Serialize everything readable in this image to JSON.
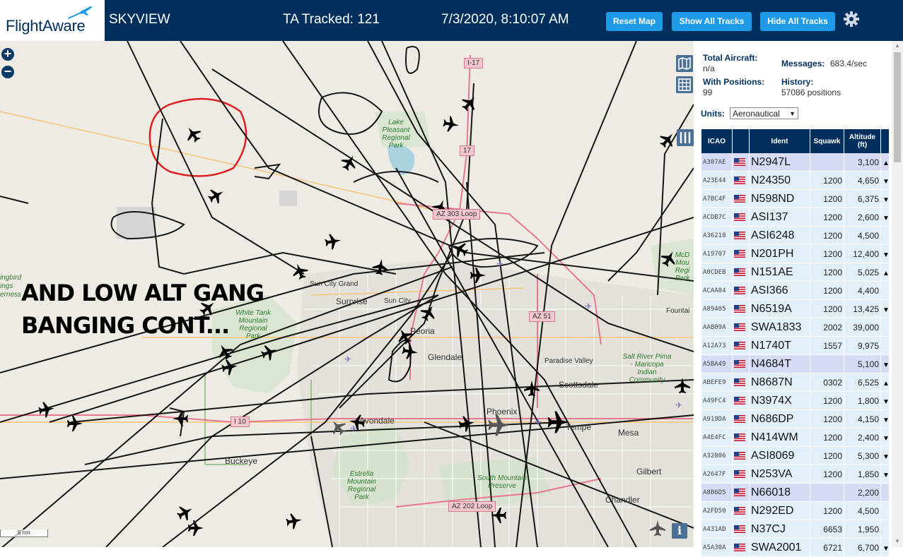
{
  "header": {
    "logo_text": "FlightAware",
    "app_title": "SKYVIEW",
    "tracked": "TA Tracked: 121",
    "datetime": "7/3/2020, 8:10:07 AM",
    "buttons": {
      "reset_map": "Reset Map",
      "show_all_tracks": "Show All Tracks",
      "hide_all_tracks": "Hide All Tracks"
    }
  },
  "map": {
    "annotation_lines": [
      "AND LOW ALT GANG",
      "BANGING CONT..."
    ],
    "annotation_color": "#000000",
    "highlight_circle_color": "#e02020",
    "places": {
      "surprise": "Surprise",
      "sun_city": "Sun City",
      "sun_city_grand": "Sun City Grand",
      "peoria": "Peoria",
      "glendale": "Glendale",
      "phoenix": "Phoenix",
      "tempe": "Tempe",
      "mesa": "Mesa",
      "scottsdale": "Scottsdale",
      "paradise_valley": "Paradise Valley",
      "avondale": "Avondale",
      "buckeye": "Buckeye",
      "gilbert": "Gilbert",
      "chandler": "Chandler",
      "fountain": "Fountai",
      "hummingbird": "ingbird",
      "springs": "ings",
      "wilderness": "erness"
    },
    "parks": {
      "white_tank": "White Tank Mountain Regional Park",
      "lake_pleasant": "Lake Pleasant Regional Park",
      "estrella": "Estrella Mountain Regional Park",
      "south_mountain": "South Mountain Preserve",
      "salt_river": "Salt River Pima - Maricopa Indian Community",
      "mcdowell": "McD Mou Regi Park"
    },
    "roads": {
      "i17": "I-17",
      "i10": "I 10",
      "az303": "AZ 303 Loop",
      "az202": "AZ 202 Loop",
      "az51": "AZ 51",
      "r17": "17"
    },
    "zoom_in": "+",
    "zoom_out": "−",
    "info": "i",
    "scale": "5 nm"
  },
  "panel": {
    "total_aircraft_label": "Total Aircraft:",
    "total_aircraft_value": "n/a",
    "with_positions_label": "With Positions:",
    "with_positions_value": "99",
    "messages_label": "Messages:",
    "messages_value": "683.4/sec",
    "history_label": "History:",
    "history_value": "57086 positions",
    "units_label": "Units:",
    "units_value": "Aeronautical",
    "columns": {
      "icao": "ICAO",
      "flag": "",
      "ident": "Ident",
      "squawk": "Squawk",
      "altitude": "Altitude (ft)"
    },
    "rows": [
      {
        "icao": "A307AE",
        "ident": "N2947L",
        "squawk": "",
        "alt": "3,100",
        "trend": "▲",
        "sel": true
      },
      {
        "icao": "A23E44",
        "ident": "N24350",
        "squawk": "1200",
        "alt": "4,650",
        "trend": "▼",
        "sel": false
      },
      {
        "icao": "A7BC4F",
        "ident": "N598ND",
        "squawk": "1200",
        "alt": "6,375",
        "trend": "▼",
        "sel": false
      },
      {
        "icao": "ACDB7C",
        "ident": "ASI137",
        "squawk": "1200",
        "alt": "2,600",
        "trend": "▼",
        "sel": false
      },
      {
        "icao": "A36218",
        "ident": "ASI6248",
        "squawk": "1200",
        "alt": "4,500",
        "trend": "",
        "sel": false
      },
      {
        "icao": "A19707",
        "ident": "N201PH",
        "squawk": "1200",
        "alt": "12,400",
        "trend": "▼",
        "sel": false
      },
      {
        "icao": "A0CDEB",
        "ident": "N151AE",
        "squawk": "1200",
        "alt": "5,025",
        "trend": "▲",
        "sel": false
      },
      {
        "icao": "ACAA84",
        "ident": "ASI366",
        "squawk": "1200",
        "alt": "4,400",
        "trend": "",
        "sel": false
      },
      {
        "icao": "A89405",
        "ident": "N6519A",
        "squawk": "1200",
        "alt": "13,425",
        "trend": "▼",
        "sel": false
      },
      {
        "icao": "AAB09A",
        "ident": "SWA1833",
        "squawk": "2002",
        "alt": "39,000",
        "trend": "",
        "sel": false
      },
      {
        "icao": "A12A73",
        "ident": "N1740T",
        "squawk": "1557",
        "alt": "9,975",
        "trend": "",
        "sel": false
      },
      {
        "icao": "A5BA49",
        "ident": "N4684T",
        "squawk": "",
        "alt": "5,100",
        "trend": "▼",
        "sel": true
      },
      {
        "icao": "ABEFE9",
        "ident": "N8687N",
        "squawk": "0302",
        "alt": "6,525",
        "trend": "▲",
        "sel": false
      },
      {
        "icao": "A49FC4",
        "ident": "N3974X",
        "squawk": "1200",
        "alt": "1,800",
        "trend": "▼",
        "sel": false
      },
      {
        "icao": "A919DA",
        "ident": "N686DP",
        "squawk": "1200",
        "alt": "4,150",
        "trend": "▼",
        "sel": false
      },
      {
        "icao": "A4E4FC",
        "ident": "N414WM",
        "squawk": "1200",
        "alt": "2,400",
        "trend": "▼",
        "sel": false
      },
      {
        "icao": "A32806",
        "ident": "ASI8069",
        "squawk": "1200",
        "alt": "5,300",
        "trend": "▼",
        "sel": false
      },
      {
        "icao": "A2647F",
        "ident": "N253VA",
        "squawk": "1200",
        "alt": "1,850",
        "trend": "▼",
        "sel": false
      },
      {
        "icao": "A8B6D5",
        "ident": "N66018",
        "squawk": "",
        "alt": "2,200",
        "trend": "",
        "sel": true
      },
      {
        "icao": "A2FD50",
        "ident": "N292ED",
        "squawk": "1200",
        "alt": "4,500",
        "trend": "",
        "sel": false
      },
      {
        "icao": "A431AD",
        "ident": "N37CJ",
        "squawk": "6653",
        "alt": "1,950",
        "trend": "",
        "sel": false
      },
      {
        "icao": "A5A30A",
        "ident": "SWA2001",
        "squawk": "6721",
        "alt": "6,700",
        "trend": "▼",
        "sel": false
      }
    ]
  },
  "colors": {
    "header_bg": "#002f5d",
    "button_bg": "#1e9ae8",
    "row_bg": "#e3f0f9",
    "row_selected_bg": "#d6dcf6"
  }
}
